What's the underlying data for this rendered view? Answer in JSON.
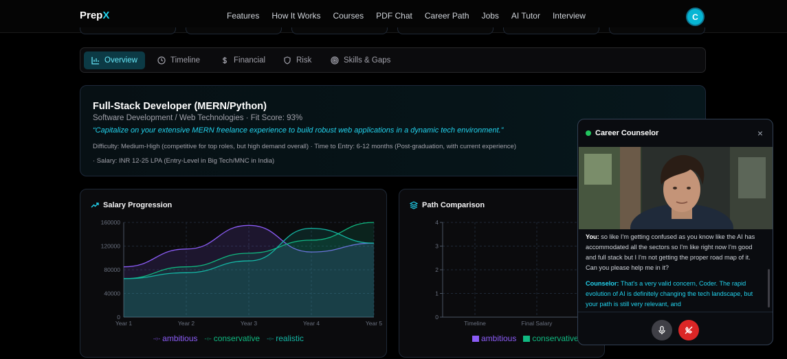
{
  "nav": {
    "logo_main": "Prep",
    "logo_accent": "X",
    "links": [
      "Features",
      "How It Works",
      "Courses",
      "PDF Chat",
      "Career Path",
      "Jobs",
      "AI Tutor",
      "Interview"
    ],
    "avatar_initial": "C"
  },
  "tabs": [
    {
      "label": "Overview",
      "icon": "bar-chart-icon",
      "active": true
    },
    {
      "label": "Timeline",
      "icon": "clock-icon",
      "active": false
    },
    {
      "label": "Financial",
      "icon": "dollar-icon",
      "active": false
    },
    {
      "label": "Risk",
      "icon": "shield-icon",
      "active": false
    },
    {
      "label": "Skills & Gaps",
      "icon": "target-icon",
      "active": false
    }
  ],
  "role": {
    "title": "Full-Stack Developer (MERN/Python)",
    "subtitle": "Software Development / Web Technologies · Fit Score: 93%",
    "quote": "“Capitalize on your extensive MERN freelance experience to build robust web applications in a dynamic tech environment.”",
    "meta_line1": "Difficulty: Medium-High (competitive for top roles, but high demand overall)   · Time to Entry: 6-12 months (Post-graduation, with current experience)",
    "meta_line2": "· Salary: INR 12-25 LPA (Entry-Level in Big Tech/MNC in India)"
  },
  "salary_card": {
    "title": "Salary Progression",
    "icon": "trending-up-icon"
  },
  "path_card": {
    "title": "Path Comparison",
    "icon": "layers-icon"
  },
  "chart_data": [
    {
      "type": "area",
      "x": [
        "Year 1",
        "Year 2",
        "Year 3",
        "Year 4",
        "Year 5"
      ],
      "ylim": [
        0,
        160000
      ],
      "yticks": [
        "0",
        "40000",
        "80000",
        "120000",
        "160000"
      ],
      "series": [
        {
          "name": "ambitious",
          "color": "#8b5cf6",
          "values": [
            85000,
            115000,
            155000,
            110000,
            125000
          ]
        },
        {
          "name": "conservative",
          "color": "#10b981",
          "values": [
            65000,
            85000,
            108000,
            130000,
            160000
          ]
        },
        {
          "name": "realistic",
          "color": "#14b8a6",
          "values": [
            65000,
            75000,
            95000,
            150000,
            125000
          ]
        }
      ]
    },
    {
      "type": "bar",
      "categories": [
        "Timeline",
        "Final Salary"
      ],
      "ylim": [
        0,
        4
      ],
      "yticks": [
        "0",
        "1",
        "2",
        "3",
        "4"
      ],
      "series": [
        {
          "name": "ambitious",
          "color": "#8b5cf6"
        },
        {
          "name": "conservative",
          "color": "#10b981"
        }
      ]
    }
  ],
  "counselor": {
    "title": "Career Counselor",
    "close": "×",
    "you_label": "You:",
    "you_text": "so like I'm getting confused as you know like the AI has accommodated all the sectors so I'm like right now I'm good and full stack but I I'm not getting the proper road map of it. Can you please help me in it?",
    "co_label": "Counselor:",
    "co_text": "That's a very valid concern, Coder. The rapid evolution of AI is definitely changing the tech landscape, but your path is still very relevant, and"
  },
  "colors": {
    "accent": "#22d3ee",
    "end_call": "#dc2626",
    "online": "#22c55e"
  }
}
